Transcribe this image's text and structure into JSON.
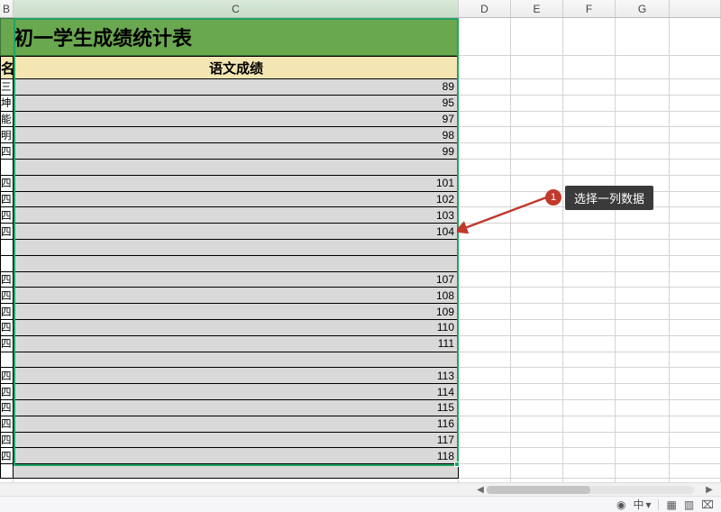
{
  "columns": {
    "B": "B",
    "C": "C",
    "D": "D",
    "E": "E",
    "F": "F",
    "G": "G"
  },
  "title": "初一学生成绩统计表",
  "headers": {
    "name": "名",
    "score": "语文成绩"
  },
  "rows": [
    {
      "name": "三",
      "score": "89"
    },
    {
      "name": "坤",
      "score": "95"
    },
    {
      "name": "能",
      "score": "97"
    },
    {
      "name": "明",
      "score": "98"
    },
    {
      "name": "四",
      "score": "99"
    },
    {
      "name": "",
      "score": ""
    },
    {
      "name": "四",
      "score": "101"
    },
    {
      "name": "四",
      "score": "102"
    },
    {
      "name": "四",
      "score": "103"
    },
    {
      "name": "四",
      "score": "104"
    },
    {
      "name": "",
      "score": ""
    },
    {
      "name": "",
      "score": ""
    },
    {
      "name": "四",
      "score": "107"
    },
    {
      "name": "四",
      "score": "108"
    },
    {
      "name": "四",
      "score": "109"
    },
    {
      "name": "四",
      "score": "110"
    },
    {
      "name": "四",
      "score": "111"
    },
    {
      "name": "",
      "score": ""
    },
    {
      "name": "四",
      "score": "113"
    },
    {
      "name": "四",
      "score": "114"
    },
    {
      "name": "四",
      "score": "115"
    },
    {
      "name": "四",
      "score": "116"
    },
    {
      "name": "四",
      "score": "117"
    },
    {
      "name": "四",
      "score": "118"
    }
  ],
  "annotation": {
    "step": "1",
    "text": "选择一列数据"
  },
  "status": {
    "eye": "◉",
    "cjk": "中",
    "dd": "▾",
    "grid": "▦",
    "cols": "▥",
    "page": "�ည"
  },
  "chart_data": {
    "type": "table",
    "title": "初一学生成绩统计表",
    "columns": [
      "姓名(partial)",
      "语文成绩"
    ],
    "rows": [
      [
        "三",
        89
      ],
      [
        "坤",
        95
      ],
      [
        "能",
        97
      ],
      [
        "明",
        98
      ],
      [
        "四",
        99
      ],
      [
        "",
        null
      ],
      [
        "四",
        101
      ],
      [
        "四",
        102
      ],
      [
        "四",
        103
      ],
      [
        "四",
        104
      ],
      [
        "",
        null
      ],
      [
        "",
        null
      ],
      [
        "四",
        107
      ],
      [
        "四",
        108
      ],
      [
        "四",
        109
      ],
      [
        "四",
        110
      ],
      [
        "四",
        111
      ],
      [
        "",
        null
      ],
      [
        "四",
        113
      ],
      [
        "四",
        114
      ],
      [
        "四",
        115
      ],
      [
        "四",
        116
      ],
      [
        "四",
        117
      ],
      [
        "四",
        118
      ]
    ]
  }
}
